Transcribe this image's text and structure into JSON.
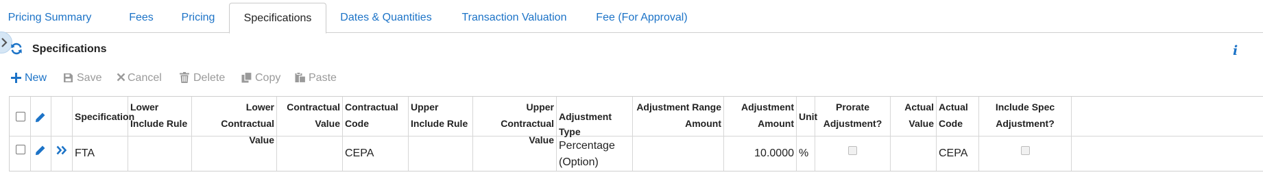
{
  "tabs": [
    {
      "label": "Pricing Summary"
    },
    {
      "label": "Fees"
    },
    {
      "label": "Pricing"
    },
    {
      "label": "Specifications"
    },
    {
      "label": "Dates & Quantities"
    },
    {
      "label": "Transaction Valuation"
    },
    {
      "label": "Fee (For Approval)"
    }
  ],
  "active_tab": "Specifications",
  "panel": {
    "title": "Specifications",
    "info_icon": "i"
  },
  "toolbar": {
    "new_label": "New",
    "save_label": "Save",
    "cancel_label": "Cancel",
    "delete_label": "Delete",
    "copy_label": "Copy",
    "paste_label": "Paste"
  },
  "table": {
    "columns": [
      "Specification",
      "Lower Include Rule",
      "Lower Contractual Value",
      "Contractual Value",
      "Contractual Code",
      "Upper Include Rule",
      "Upper Contractual Value",
      "Adjustment Type",
      "Adjustment Range Amount",
      "Adjustment Amount",
      "Unit",
      "Prorate Adjustment?",
      "Actual Value",
      "Actual Code",
      "Include Spec Adjustment?"
    ],
    "rows": [
      {
        "specification": "FTA",
        "lower_include_rule": "",
        "lower_contractual_value": "",
        "contractual_value": "",
        "contractual_code": "CEPA",
        "upper_include_rule": "",
        "upper_contractual_value": "",
        "adjustment_type": "Percentage (Option)",
        "adjustment_range_amount": "",
        "adjustment_amount": "10.0000",
        "unit": "%",
        "prorate_adjustment": false,
        "actual_value": "",
        "actual_code": "CEPA",
        "include_spec_adjustment": false
      }
    ]
  },
  "colors": {
    "link_blue": "#1c73c7",
    "disabled_gray": "#9a9a9a",
    "border": "#cfcfcf"
  }
}
